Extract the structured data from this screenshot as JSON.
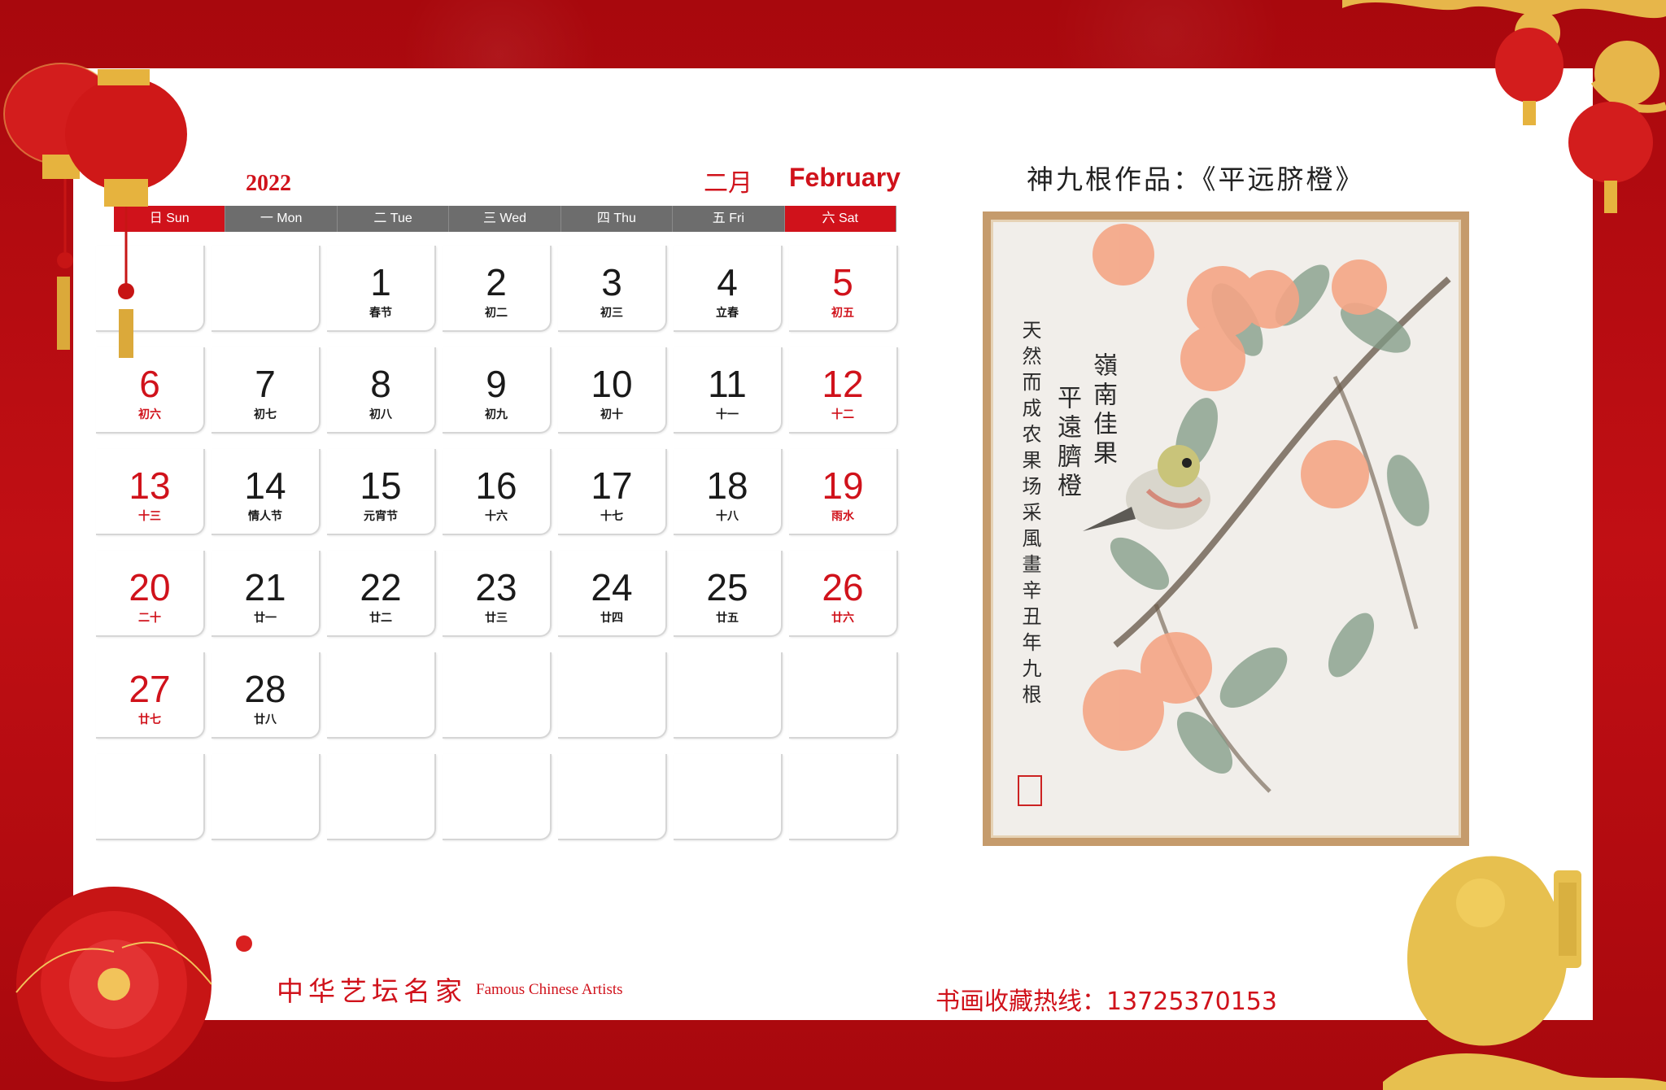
{
  "calendar": {
    "year": "2022",
    "month_cn": "二月",
    "month_en": "February",
    "weekdays": [
      "日 Sun",
      "一 Mon",
      "二 Tue",
      "三 Wed",
      "四 Thu",
      "五 Fri",
      "六 Sat"
    ],
    "rows": [
      [
        {
          "n": "",
          "l": ""
        },
        {
          "n": "",
          "l": ""
        },
        {
          "n": "1",
          "l": "春节"
        },
        {
          "n": "2",
          "l": "初二"
        },
        {
          "n": "3",
          "l": "初三"
        },
        {
          "n": "4",
          "l": "立春"
        },
        {
          "n": "5",
          "l": "初五"
        }
      ],
      [
        {
          "n": "6",
          "l": "初六"
        },
        {
          "n": "7",
          "l": "初七"
        },
        {
          "n": "8",
          "l": "初八"
        },
        {
          "n": "9",
          "l": "初九"
        },
        {
          "n": "10",
          "l": "初十"
        },
        {
          "n": "11",
          "l": "十一"
        },
        {
          "n": "12",
          "l": "十二"
        }
      ],
      [
        {
          "n": "13",
          "l": "十三"
        },
        {
          "n": "14",
          "l": "情人节"
        },
        {
          "n": "15",
          "l": "元宵节"
        },
        {
          "n": "16",
          "l": "十六"
        },
        {
          "n": "17",
          "l": "十七"
        },
        {
          "n": "18",
          "l": "十八"
        },
        {
          "n": "19",
          "l": "雨水"
        }
      ],
      [
        {
          "n": "20",
          "l": "二十"
        },
        {
          "n": "21",
          "l": "廿一"
        },
        {
          "n": "22",
          "l": "廿二"
        },
        {
          "n": "23",
          "l": "廿三"
        },
        {
          "n": "24",
          "l": "廿四"
        },
        {
          "n": "25",
          "l": "廿五"
        },
        {
          "n": "26",
          "l": "廿六"
        }
      ],
      [
        {
          "n": "27",
          "l": "廿七"
        },
        {
          "n": "28",
          "l": "廿八"
        },
        {
          "n": "",
          "l": ""
        },
        {
          "n": "",
          "l": ""
        },
        {
          "n": "",
          "l": ""
        },
        {
          "n": "",
          "l": ""
        },
        {
          "n": "",
          "l": ""
        }
      ],
      [
        {
          "n": "",
          "l": ""
        },
        {
          "n": "",
          "l": ""
        },
        {
          "n": "",
          "l": ""
        },
        {
          "n": "",
          "l": ""
        },
        {
          "n": "",
          "l": ""
        },
        {
          "n": "",
          "l": ""
        },
        {
          "n": "",
          "l": ""
        }
      ]
    ]
  },
  "painting": {
    "title": "神九根作品：《平远脐橙》",
    "poem_line1": "嶺南佳果",
    "poem_line2": "平遠臍橙",
    "poem_line3": "天然而成农果场采風畫辛丑年九根"
  },
  "footer": {
    "brand_cn": "中华艺坛名家",
    "brand_en": "Famous Chinese Artists",
    "hotline": "书画收藏热线：13725370153"
  },
  "colors": {
    "accent_red": "#d0121b",
    "gold": "#e2b64a"
  },
  "icons": [
    "lantern-icon",
    "peony-flower-icon",
    "tiger-papercut-icon",
    "cloud-ornament-icon"
  ]
}
